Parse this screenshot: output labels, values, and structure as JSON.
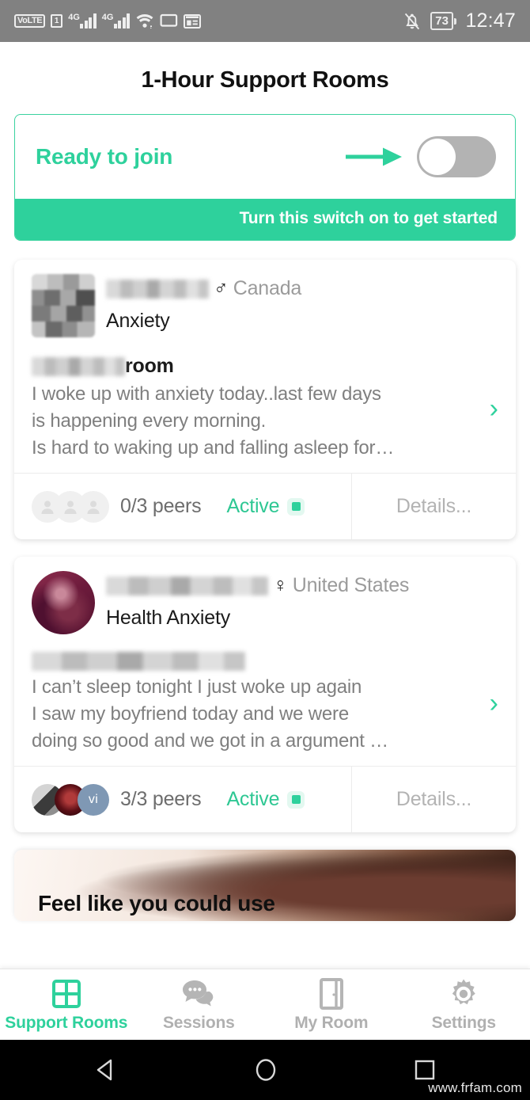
{
  "status_bar": {
    "volte_label": "VoLTE",
    "sim_label": "1",
    "network_gen_1": "4G",
    "network_gen_2": "4G",
    "icons": [
      "volte-icon",
      "sim-icon",
      "signal-bars-icon",
      "signal-bars-icon",
      "wifi-icon",
      "cast-icon",
      "calendar-icon",
      "notifications-muted-icon",
      "battery-icon"
    ],
    "battery_percent": "73",
    "time": "12:47"
  },
  "header": {
    "title": "1-Hour Support Rooms"
  },
  "ready_panel": {
    "label": "Ready to join",
    "hint": "Turn this switch on to get started",
    "switch_state": "off",
    "accent_color": "#2ed19c",
    "switch_track_color": "#b3b3b3"
  },
  "rooms": [
    {
      "avatar": "blurred-pixelated-avatar",
      "name_redacted": true,
      "name_width": 130,
      "gender_icon": "male-symbol",
      "gender_glyph": "♂",
      "country": "Canada",
      "topic": "Anxiety",
      "room_title_redacted": true,
      "room_title_width": 118,
      "room_title": "room",
      "excerpt": "I woke up with anxiety today..last few days\nis happening every morning.\nIs hard to waking up and falling asleep for…",
      "chevron": "›",
      "peers": "0/3 peers",
      "peers_joined": 0,
      "peers_total": 3,
      "status": "Active",
      "details": "Details..."
    },
    {
      "avatar": "portrait-photo-avatar",
      "name_redacted": true,
      "name_width": 205,
      "gender_icon": "female-symbol",
      "gender_glyph": "♀",
      "country": "United States",
      "topic": "Health Anxiety",
      "room_title_redacted": true,
      "room_title_width": 270,
      "room_title": "",
      "excerpt": " I can’t sleep tonight I just woke up again\nI saw my boyfriend today and we were\ndoing so good and we got in a argument …",
      "chevron": "›",
      "peers": "3/3 peers",
      "peers_joined": 3,
      "peers_total": 3,
      "peer_badge_label": "vi",
      "status": "Active",
      "details": "Details..."
    }
  ],
  "promo": {
    "text": "Feel like you could use"
  },
  "tabs": [
    {
      "label": "Support Rooms",
      "icon": "grid-icon",
      "active": true
    },
    {
      "label": "Sessions",
      "icon": "chat-bubbles-icon",
      "active": false
    },
    {
      "label": "My Room",
      "icon": "door-icon",
      "active": false
    },
    {
      "label": "Settings",
      "icon": "gear-icon",
      "active": false
    }
  ],
  "android_nav": {
    "back": "back-triangle-icon",
    "home": "home-circle-icon",
    "recents": "recents-square-icon"
  },
  "watermark": "www.frfam.com"
}
